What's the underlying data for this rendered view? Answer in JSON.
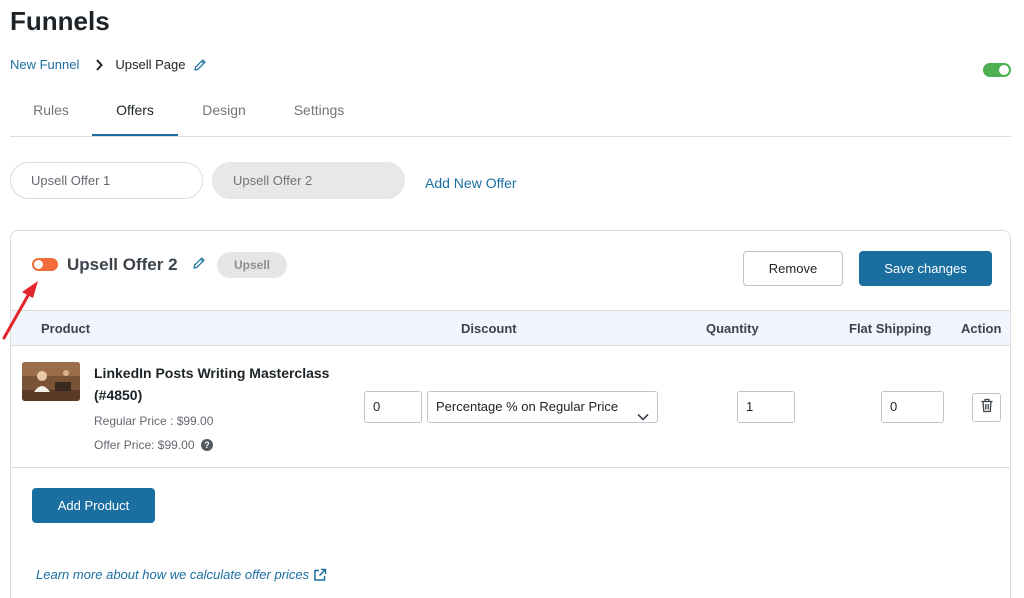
{
  "page": {
    "title": "Funnels"
  },
  "breadcrumb": {
    "parent": "New Funnel",
    "current": "Upsell Page"
  },
  "tabs": [
    {
      "label": "Rules",
      "active": false
    },
    {
      "label": "Offers",
      "active": true
    },
    {
      "label": "Design",
      "active": false
    },
    {
      "label": "Settings",
      "active": false
    }
  ],
  "offers": {
    "pills": [
      {
        "label": "Upsell Offer 1",
        "selected": false
      },
      {
        "label": "Upsell Offer 2",
        "selected": true
      }
    ],
    "add_new_label": "Add New Offer"
  },
  "offer_card": {
    "name": "Upsell Offer 2",
    "type_badge": "Upsell",
    "enabled": true,
    "remove_label": "Remove",
    "save_label": "Save changes",
    "columns": {
      "product": "Product",
      "discount": "Discount",
      "quantity": "Quantity",
      "shipping": "Flat Shipping",
      "action": "Action"
    },
    "row": {
      "product_name": "LinkedIn Posts Writing Masterclass (#4850)",
      "regular_price": "Regular Price : $99.00",
      "offer_price": "Offer Price: $99.00",
      "discount_value": "0",
      "discount_type": "Percentage % on Regular Price",
      "quantity": "1",
      "flat_shipping": "0"
    },
    "add_product_label": "Add Product",
    "learn_more": "Learn more about how we calculate offer prices"
  },
  "colors": {
    "accent": "#1a6fa0",
    "global_toggle_on": "#4caf50",
    "offer_toggle": "#f26b3a",
    "annotation_arrow": "#e3262b"
  },
  "icons": {
    "breadcrumb_separator": "chevron-right-icon",
    "edit": "pencil-icon",
    "select": "chevron-down-icon",
    "delete": "trash-icon",
    "help": "question-circle-icon",
    "external": "external-link-icon"
  }
}
